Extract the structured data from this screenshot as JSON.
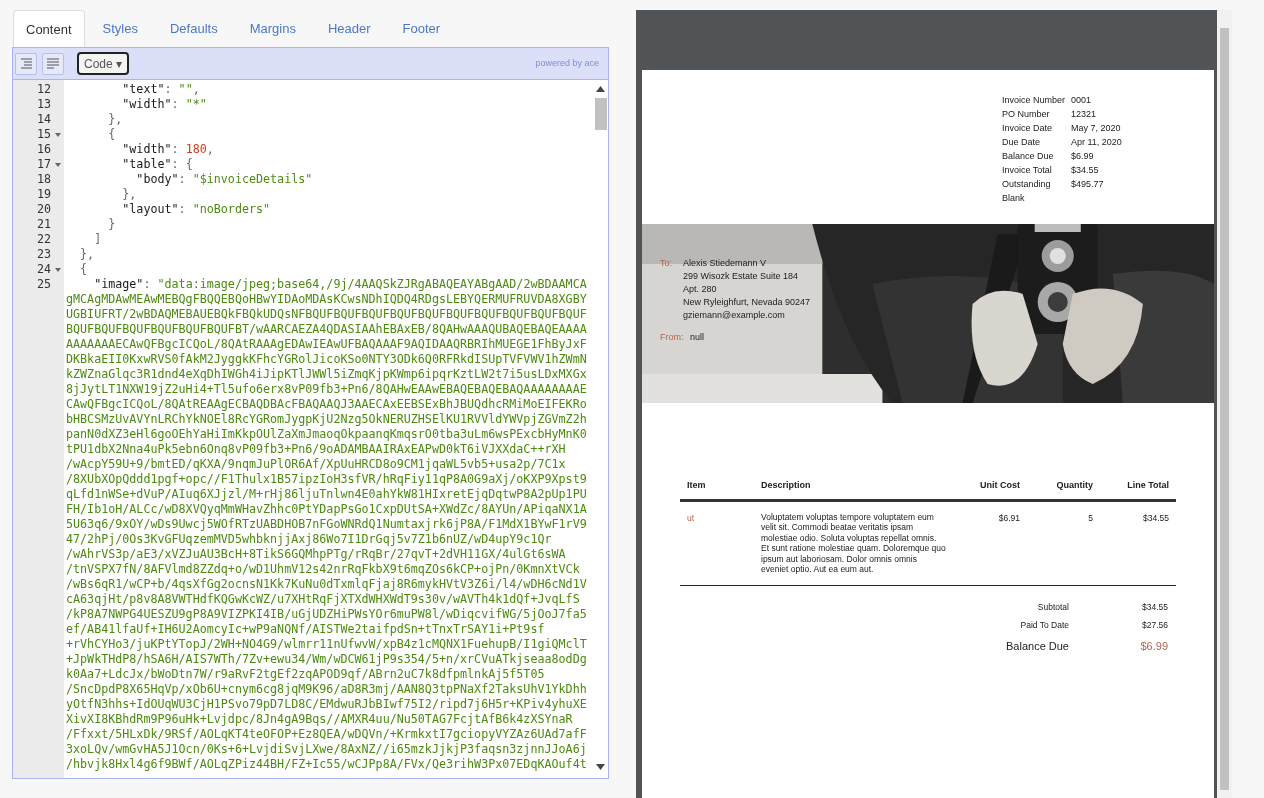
{
  "tabs": [
    {
      "label": "Content",
      "selected": true
    },
    {
      "label": "Styles",
      "selected": false
    },
    {
      "label": "Defaults",
      "selected": false
    },
    {
      "label": "Margins",
      "selected": false
    },
    {
      "label": "Header",
      "selected": false
    },
    {
      "label": "Footer",
      "selected": false
    }
  ],
  "editor": {
    "mode_button": "Code ▾",
    "credit": "powered by ace",
    "lines": [
      {
        "number": "12",
        "foldable": false,
        "tokens": [
          {
            "kind": "key",
            "text": "        \"text\""
          },
          {
            "kind": "punct",
            "text": ": "
          },
          {
            "kind": "string",
            "text": "\"\""
          },
          {
            "kind": "punct",
            "text": ","
          }
        ]
      },
      {
        "number": "13",
        "foldable": false,
        "tokens": [
          {
            "kind": "key",
            "text": "        \"width\""
          },
          {
            "kind": "punct",
            "text": ": "
          },
          {
            "kind": "string",
            "text": "\"*\""
          }
        ]
      },
      {
        "number": "14",
        "foldable": false,
        "tokens": [
          {
            "kind": "punct",
            "text": "      },"
          }
        ]
      },
      {
        "number": "15",
        "foldable": true,
        "tokens": [
          {
            "kind": "punct",
            "text": "      {"
          }
        ]
      },
      {
        "number": "16",
        "foldable": false,
        "tokens": [
          {
            "kind": "key",
            "text": "        \"width\""
          },
          {
            "kind": "punct",
            "text": ": "
          },
          {
            "kind": "number",
            "text": "180"
          },
          {
            "kind": "punct",
            "text": ","
          }
        ]
      },
      {
        "number": "17",
        "foldable": true,
        "tokens": [
          {
            "kind": "key",
            "text": "        \"table\""
          },
          {
            "kind": "punct",
            "text": ": {"
          }
        ]
      },
      {
        "number": "18",
        "foldable": false,
        "tokens": [
          {
            "kind": "key",
            "text": "          \"body\""
          },
          {
            "kind": "punct",
            "text": ": "
          },
          {
            "kind": "string",
            "text": "\"$invoiceDetails\""
          }
        ]
      },
      {
        "number": "19",
        "foldable": false,
        "tokens": [
          {
            "kind": "punct",
            "text": "        },"
          }
        ]
      },
      {
        "number": "20",
        "foldable": false,
        "tokens": [
          {
            "kind": "key",
            "text": "        \"layout\""
          },
          {
            "kind": "punct",
            "text": ": "
          },
          {
            "kind": "string",
            "text": "\"noBorders\""
          }
        ]
      },
      {
        "number": "21",
        "foldable": false,
        "tokens": [
          {
            "kind": "punct",
            "text": "      }"
          }
        ]
      },
      {
        "number": "22",
        "foldable": false,
        "tokens": [
          {
            "kind": "punct",
            "text": "    ]"
          }
        ]
      },
      {
        "number": "23",
        "foldable": false,
        "tokens": [
          {
            "kind": "punct",
            "text": "  },"
          }
        ]
      },
      {
        "number": "24",
        "foldable": true,
        "tokens": [
          {
            "kind": "punct",
            "text": "  {"
          }
        ]
      },
      {
        "number": "25",
        "foldable": false,
        "tokens": [
          {
            "kind": "key",
            "text": "    \"image\""
          },
          {
            "kind": "punct",
            "text": ": "
          },
          {
            "kind": "string",
            "text": "\"data:image/jpeg;base64,/9j/4AAQSkZJRgABAQEAYABgAAD/2wBDAAMCA"
          }
        ],
        "continuation": [
          "gMCAgMDAwMEAwMEBQgFBQQEBQoHBwYIDAoMDAsKCwsNDhIQDQ4RDgsLEBYQERMUFRUVDA8XGBY",
          "UGBIUFRT/2wBDAQMEBAUEBQkFBQkUDQsNFBQUFBQUFBQUFBQUFBQUFBQUFBQUFBQUFBQUFBQUF",
          "BQUFBQUFBQUFBQUFBQUFBQUFBT/wAARCAEZA4QDASIAAhEBAxEB/8QAHwAAAQUBAQEBAQEAAAA",
          "AAAAAAAECAwQFBgcICQoL/8QAtRAAAgEDAwIEAwUFBAQAAAF9AQIDAAQRBRIhMUEGE1FhByJxF",
          "DKBkaEII0KxwRVS0fAkM2JyggkKFhcYGRolJicoKSo0NTY3ODk6Q0RFRkdISUpTVFVWV1hZWmN",
          "kZWZnaGlqc3R1dnd4eXqDhIWGh4iJipKTlJWWl5iZmqKjpKWmp6ipqrKztLW2t7i5usLDxMXGx",
          "8jJytLT1NXW19jZ2uHi4+Tl5ufo6erx8vP09fb3+Pn6/8QAHwEAAwEBAQEBAQEBAQAAAAAAAAE",
          "CAwQFBgcICQoL/8QAtREAAgECBAQDBAcFBAQAAQJ3AAECAxEEBSExBhJBUQdhcRMiMoEIFEKRo",
          "bHBCSMzUvAVYnLRChYkNOEl8RcYGRomJygpKjU2Nzg5OkNERUZHSElKU1RVVldYWVpjZGVmZ2h",
          "panN0dXZ3eHl6goOEhYaHiImKkpOUlZaXmJmaoqOkpaanqKmqsrO0tba3uLm6wsPExcbHyMnK0",
          "tPU1dbX2Nna4uPk5ebn6Onq8vP09fb3+Pn6/9oADAMBAAIRAxEAPwD0kT6iVJXXdaC++rXH",
          "/wAcpY59U+9/bmtED/qKXA/9nqmJuPlOR6Af/XpUuHRCD8o9CM1jqaWL5vb5+usa2p/7C1x",
          "/8XUbXOpQddd1pgf+opc//F1Thulx1B57ipzIoH3sfVR/hRqFiy11qP8A0G9aXj/oKXP9Xpst9",
          "qLfd1nWSe+dVuP/AIuq6XJjzl/M+rHj86ljuTnlwn4E0ahYkW81HIxretEjqDqtwP8A2pUp1PU",
          "FH/Ib1oH/ALCc/wD8XVQyqMmWHavZhhc0PtYDapPsGo1CxpDUtSA+XWdZc/8AYUn/APiqaNX1A",
          "5U63q6/9xOY/wDs9Uwcj5WOfRTzUABDHOB7nFGoWNRdQ1Numtaxjrk6jP8A/F1MdX1BYwF1rV9",
          "47/2hPj/0Os3KvGFUqzemMVD5whbknjjAxj86Wo7I1DrGqj5v7Z1b6nUZ/wD4upY9c1Qr",
          "/wAhrVS3p/aE3/xVZJuAU3BcH+8TikS6GQMhpPTg/rRqBr/27qvT+2dVH11GX/4ulGt6sWA",
          "/tnVSPX7fN/8AFVlmd8ZZdq+o/wD1UhmV12s42nrRqFkbX9t6mqZOs6kCP+ojPn/0KmnXtVCk",
          "/wBs6qR1/wCP+b/4qsXfGg2ocnsN1Kk7KuNu0dTxmlqFjaj8R6mykHVtV3Z6i/l4/wDH6cNd1V",
          "cA63qjHt/p8v8A8VWTHdfKQGwKcWZ/u7XHtRqFjXTXdWHXWdT9s30v/wAVTh4k1dQf+JvqLfS",
          "/kP8A7NWPG4UESZU9gP8A9VIZPKI4IB/uGjUDZHiPWsYOr6muPW8l/wDiqcvifWG/5jOoJ7fa5",
          "ef/AB41lfaUf+IH6U2AomcyIc+wP9aNQNf/AISTWe2taifpdSn+tTnxTrSAY1i+Pt9sf",
          "+rVhCYHo3/juKPtYTopJ/2WH+NO4G9/wlmrr11nUfwvW/xpB4z1cMQNX1FuehupB/I1giQMclT",
          "+JpWkTHdP8/hSA6H/AIS7WTh/7Zv+ewu34/Wm/wDCW61jP9s354/5+n/xrCVuATkjseaa8odDg",
          "k0Aa7+LdcJx/bWoDtn7W/r9aRvF2tgEf2zqAPOD9qf/ABrn2uC7k8dfpmlnkAj5f5T05",
          "/SncDpdP8X65HqVp/xOb6U+cnym6cg8jqM9K96/aD8R3mj/AAN8Q3tpPNaXf2TaksUhV1YkDhh",
          "yOtfN3hhs+IdOUqWU3CjH1PSvo79pD7LD8C/EMdwuRJbBIwf75I2/ripd7j6H5r+KPiv4yhuXE",
          "XivXI8KBhdRm9P96uHk+Lvjdpc/8Jn4gA9Bqs//AMXR4uu/Nu50TAG7FcjtAfB6k4zXSYnaR",
          "/Ffxxt/5HLxDk/9RSf/AOLqKT4teOFOP+Ez8QEA/wDQVn/+KrmkxtI7gciopyVYZAz6UAd7afF",
          "3xoLQv/wmGvHA5J1Ocn/0Ks+6+LvjdiSvjLXwe/8AxNZ//i65mzkJjkjP3faqsn3zjnnJJoA6j",
          "/hbvjk8Hxl4g6f9BWf/AOLqZPiz44BH/FZ+Ic55/wCJPp8A/FVx/Qe3rihW3Px07EDqKAOuf4t"
        ]
      }
    ]
  },
  "preview": {
    "details": [
      {
        "label": "Invoice Number",
        "value": "0001"
      },
      {
        "label": "PO Number",
        "value": "12321"
      },
      {
        "label": "Invoice Date",
        "value": "May 7, 2020"
      },
      {
        "label": "Due Date",
        "value": "Apr 11, 2020"
      },
      {
        "label": "Balance Due",
        "value": "$6.99"
      },
      {
        "label": "Invoice Total",
        "value": "$34.55"
      },
      {
        "label": "Outstanding",
        "value": "$495.77"
      },
      {
        "label": "Blank"
      }
    ],
    "bill_to": {
      "to_label": "To:",
      "to_lines": [
        "Alexis Stiedemann V",
        "299 Wisozk Estate Suite 184",
        "Apt. 280",
        "New Ryleighfurt, Nevada 90247",
        "gziemann@example.com"
      ],
      "from_label": "From:",
      "from_value": "null"
    },
    "items": {
      "columns": [
        "Item",
        "Description",
        "Unit Cost",
        "Quantity",
        "Line Total"
      ],
      "rows": [
        {
          "item": "ut",
          "description": "Voluptatem voluptas tempore voluptatem eum velit sit. Commodi beatae veritatis ipsam molestiae odio. Soluta voluptas repellat omnis. Et sunt ratione molestiae quam. Doloremque quo ipsum aut laboriosam. Dolor omnis omnis eveniet optio. Aut ea eum aut.",
          "unit_cost": "$6.91",
          "quantity": "5",
          "line_total": "$34.55"
        }
      ]
    },
    "totals": [
      {
        "kind": "normal",
        "label": "Subtotal",
        "value": "$34.55"
      },
      {
        "kind": "normal",
        "label": "Paid To Date",
        "value": "$27.56"
      },
      {
        "kind": "balance",
        "label": "Balance Due",
        "value": "$6.99"
      }
    ]
  }
}
